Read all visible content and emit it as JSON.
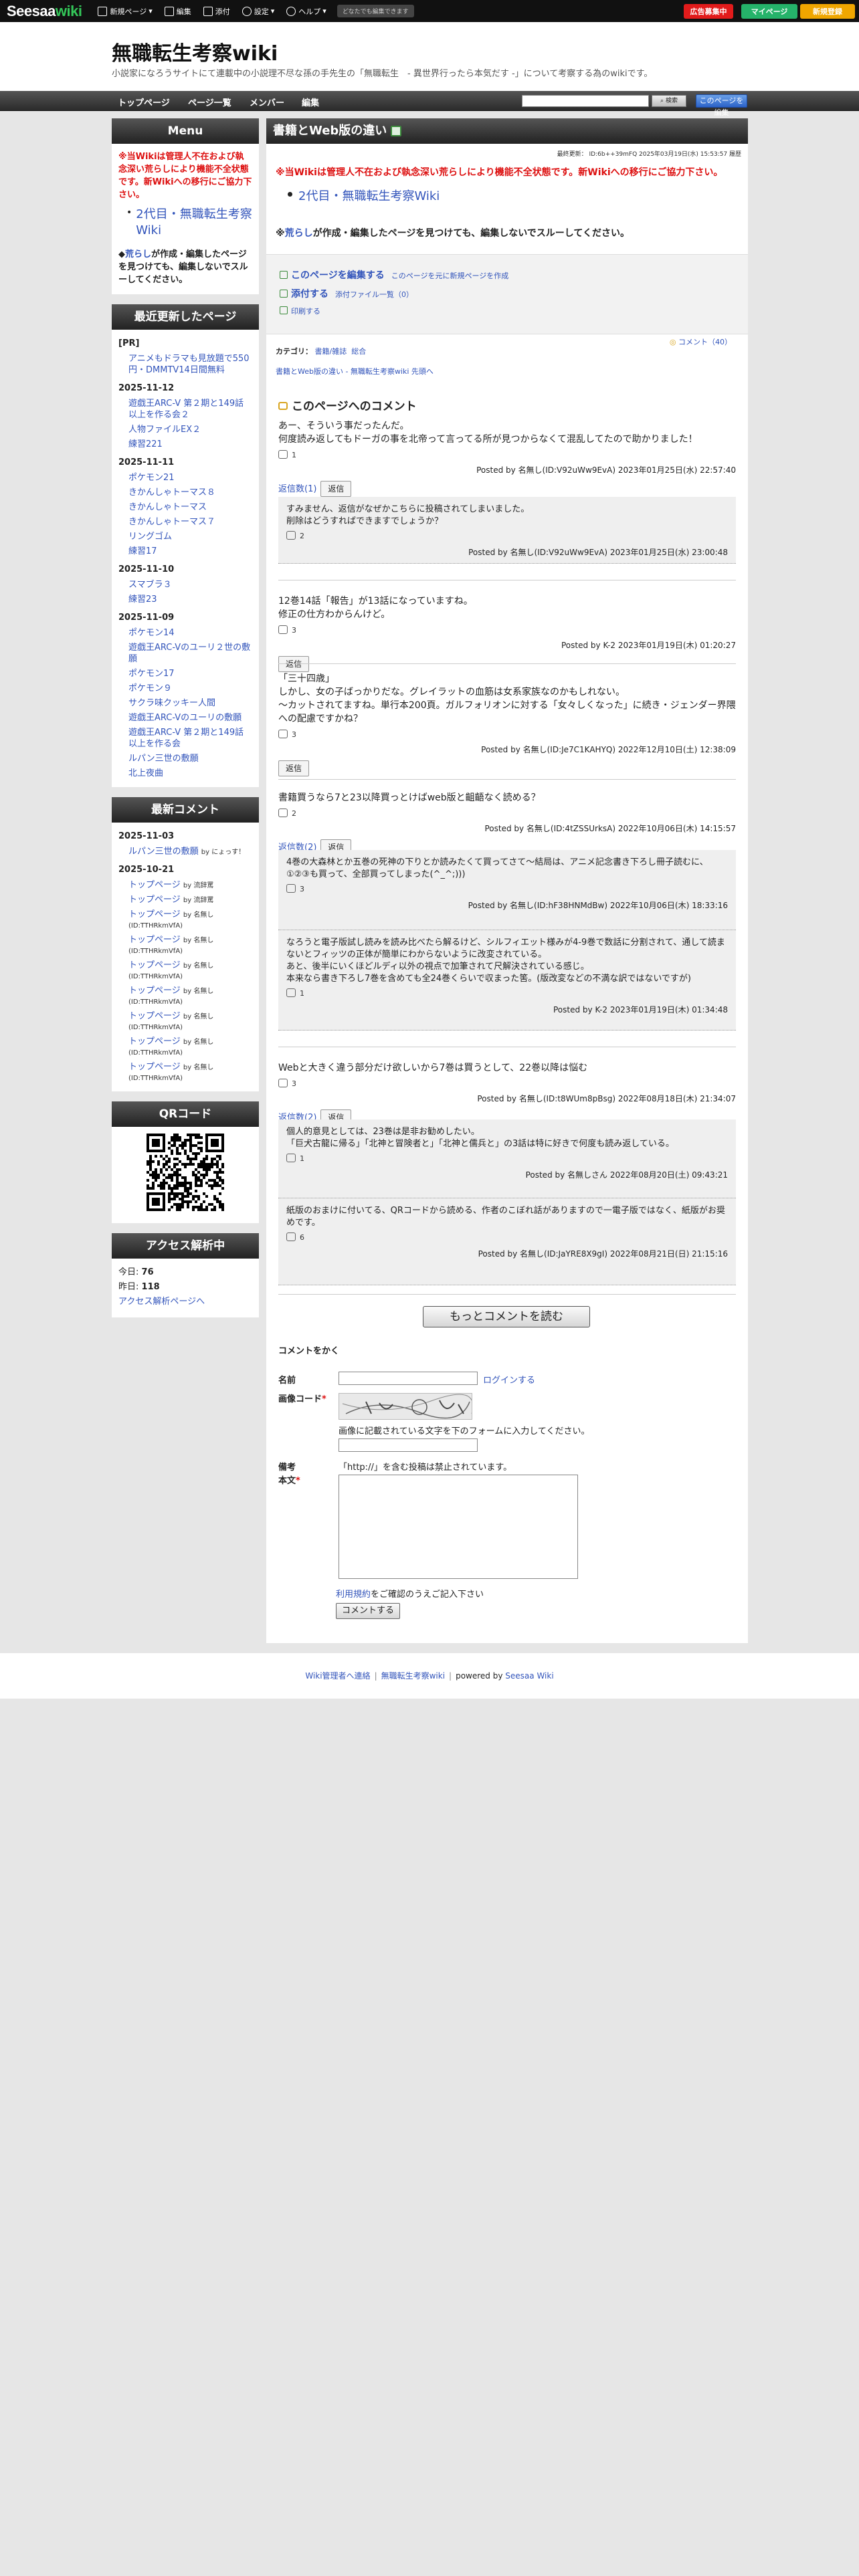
{
  "topbar": {
    "logo_a": "Seesaa",
    "logo_b": "wiki",
    "new_page": "新規ページ",
    "edit": "編集",
    "attach": "添付",
    "settings": "設定",
    "help": "ヘルプ",
    "notice_pill": "どなたでも編集できます",
    "ad_btn": "広告募集中",
    "mypage_btn": "マイページ",
    "register_btn": "新規登録"
  },
  "header": {
    "title": "無職転生考察wiki",
    "subtitle": "小説家になろうサイトにて連載中の小説理不尽な孫の手先生の「無職転生　- 異世界行ったら本気だす -」について考察する為のwikiです。"
  },
  "nav": {
    "items": [
      "トップページ",
      "ページ一覧",
      "メンバー",
      "編集"
    ],
    "search_btn": "検索",
    "edit_btn": "このページを編集"
  },
  "sidebar": {
    "menu_title": "Menu",
    "menu_notice": "※当Wikiは管理人不在および執念深い荒らしにより機能不全状態です。新Wikiへの移行にご協力下さい。",
    "menu_link": "2代目・無職転生考察Wiki",
    "menu_notice2_a": "荒らし",
    "menu_notice2_b": "が作成・編集したページを見つけても、編集しないでスルーしてください。",
    "recent_title": "最近更新したページ",
    "recent": [
      {
        "date": "[PR]",
        "items": [
          "アニメもドラマも見放題で550円・DMMTV14日間無料"
        ]
      },
      {
        "date": "2025-11-12",
        "items": [
          "遊戯王ARC-V 第２期と149話以上を作る会２",
          "人物ファイルEX２",
          "練習221"
        ]
      },
      {
        "date": "2025-11-11",
        "items": [
          "ポケモン21",
          "きかんしゃトーマス８",
          "きかんしゃトーマス",
          "きかんしゃトーマス７",
          "リングゴム",
          "練習17"
        ]
      },
      {
        "date": "2025-11-10",
        "items": [
          "スマブラ３",
          "練習23"
        ]
      },
      {
        "date": "2025-11-09",
        "items": [
          "ポケモン14",
          "遊戯王ARC-Vのユーリ２世の敷願",
          "ポケモン17",
          "ポケモン９",
          "サクラ味クッキー人間",
          "遊戯王ARC-Vのユーリの敷願",
          "遊戯王ARC-V 第２期と149話以上を作る会",
          "ルパン三世の敷願",
          "北上夜曲"
        ]
      }
    ],
    "latest_title": "最新コメント",
    "latest": [
      {
        "date": "2025-11-03",
        "items": [
          {
            "page": "ルパン三世の敷願",
            "by": "by にょっす！"
          }
        ]
      },
      {
        "date": "2025-10-21",
        "items": [
          {
            "page": "トップページ",
            "by": "by 流辞罵"
          },
          {
            "page": "トップページ",
            "by": "by 流辞罵"
          },
          {
            "page": "トップページ",
            "by": "by 名無し(ID:TTHRkmVfA)"
          },
          {
            "page": "トップページ",
            "by": "by 名無し(ID:TTHRkmVfA)"
          },
          {
            "page": "トップページ",
            "by": "by 名無し(ID:TTHRkmVfA)"
          },
          {
            "page": "トップページ",
            "by": "by 名無し(ID:TTHRkmVfA)"
          },
          {
            "page": "トップページ",
            "by": "by 名無し(ID:TTHRkmVfA)"
          },
          {
            "page": "トップページ",
            "by": "by 名無し(ID:TTHRkmVfA)"
          },
          {
            "page": "トップページ",
            "by": "by 名無し(ID:TTHRkmVfA)"
          }
        ]
      }
    ],
    "qr_title": "QRコード",
    "access_title": "アクセス解析中",
    "today_label": "今日:",
    "today_value": "76",
    "yesterday_label": "昨日:",
    "yesterday_value": "118",
    "access_link": "アクセス解析ページへ"
  },
  "main": {
    "page_title": "書籍とWeb版の違い",
    "updated": "最終更新： ID:6b++39mFQ 2025年03月19日(水) 15:53:57 履歴",
    "notice": "※当Wikiは管理人不在および執念深い荒らしにより機能不全状態です。新Wikiへの移行にご協力下さい。",
    "wiki_link": "2代目・無職転生考察Wiki",
    "notice2_a": "※",
    "notice2_b": "荒らし",
    "notice2_c": "が作成・編集したページを見つけても、編集しないでスルーしてください。",
    "edit_this": "このページを編集する",
    "edit_this_sub": "このページを元に新規ページを作成",
    "attach": "添付する",
    "attach_sub": "添付ファイル一覧（0）",
    "print": "印刷する",
    "comment_count": "コメント（40）",
    "category_label": "カテゴリ：",
    "category_items": [
      "書籍/雑誌",
      "総合"
    ],
    "breadcrumb": "書籍とWeb版の違い - 無職転生考察wiki 先頭へ",
    "comments_header": "このページへのコメント",
    "more_btn": "もっとコメントを読む"
  },
  "comments": [
    {
      "text": [
        "あー、そういう事だったんだ。",
        "何度読み返してもドーガの事を北帝って言ってる所が見つからなくて混乱してたので助かりました！"
      ],
      "likes": "1",
      "posted": "Posted by 名無し(ID:V92uWw9EvA) 2023年01月25日(水) 22:57:40",
      "reply_count": "返信数(1)",
      "reply_btn": "返信"
    },
    {
      "text": [
        "12巻14話「報告」が13話になっていますね。",
        "修正の仕方わからんけど。"
      ],
      "likes": "3",
      "posted": "Posted by K-2 2023年01月19日(木) 01:20:27",
      "reply_btn": "返信"
    },
    {
      "text": [
        "「三十四歳」",
        "しかし、女の子ばっかりだな。グレイラットの血筋は女系家族なのかもしれない。",
        "～カットされてますね。単行本200頁。ガルフォリオンに対する「女々しくなった」に続き・ジェンダー界隈への配慮ですかね？"
      ],
      "likes": "3",
      "posted": "Posted by 名無し(ID:Je7C1KAHYQ) 2022年12月10日(土) 12:38:09",
      "reply_btn": "返信"
    },
    {
      "text": [
        "書籍買うなら7と23以降買っとけばweb版と齟齬なく読める？"
      ],
      "likes": "2",
      "posted": "Posted by 名無し(ID:4tZSSUrksA) 2022年10月06日(木) 14:15:57",
      "reply_count": "返信数(2)",
      "reply_btn": "返信"
    },
    {
      "text": [
        "Webと大きく違う部分だけ欲しいから7巻は買うとして、22巻以降は悩む"
      ],
      "likes": "3",
      "posted": "Posted by 名無し(ID:t8WUm8pBsg) 2022年08月18日(木) 21:34:07",
      "reply_count": "返信数(2)",
      "reply_btn": "返信"
    }
  ],
  "replies": [
    {
      "text": [
        "すみません、返信がなぜかこちらに投稿されてしまいました。",
        "削除はどうすればできますでしょうか？"
      ],
      "likes": "2",
      "posted": "Posted by 名無し(ID:V92uWw9EvA) 2023年01月25日(水) 23:00:48"
    },
    {
      "text": [
        "4巻の大森林とか五巻の死神の下りとか読みたくて買ってさて～結局は、アニメ記念書き下ろし冊子読むに、①②③も買って、全部買ってしまった(^_^;)))"
      ],
      "likes": "3",
      "posted": "Posted by 名無し(ID:hF38HNMdBw) 2022年10月06日(木) 18:33:16"
    },
    {
      "text": [
        "なろうと電子版試し読みを読み比べたら解るけど、シルフィエット様みが4-9巻で数話に分割されて、通して読まないとフィッツの正体が簡単にわからないように改変されている。",
        "あと、後半にいくほどルディ以外の視点で加筆されて尺解決されている感じ。",
        "本来なら書き下ろし7巻を含めても全24巻くらいで収まった筈。(版改変などの不満な訳ではないですが)"
      ],
      "likes": "1",
      "posted": "Posted by K-2 2023年01月19日(木) 01:34:48"
    },
    {
      "text": [
        "個人的意見としては、23巻は是非お勧めしたい。",
        "「巨犬古龍に帰る」「北神と冒険者と」「北神と儒兵と」の3話は特に好きで何度も読み返している。"
      ],
      "likes": "1",
      "posted": "Posted by 名無しさん 2022年08月20日(土) 09:43:21"
    },
    {
      "text": [
        "紙版のおまけに付いてる、QRコードから読める、作者のこぼれ話がありますので一電子版ではなく、紙版がお奨めです。"
      ],
      "likes": "6",
      "posted": "Posted by 名無し(ID:JaYRE8X9gI) 2022年08月21日(日) 21:15:16"
    }
  ],
  "form": {
    "header": "コメントをかく",
    "name_label": "名前",
    "login_link": "ログインする",
    "captcha_label": "画像コード",
    "captcha_hint": "画像に記載されている文字を下のフォームに入力してください。",
    "note_label": "備考",
    "note_text": "「http://」を含む投稿は禁止されています。",
    "body_label": "本文",
    "terms_link": "利用規約",
    "terms_text": "をご確認のうえご記入下さい",
    "submit": "コメントする"
  },
  "footer": {
    "contact": "Wiki管理者へ連絡",
    "site": "無職転生考察wiki",
    "powered_by": "powered by",
    "seesaa": "Seesaa Wiki"
  },
  "colors": {
    "accent": "#3355bb",
    "red": "#dd1111",
    "dark": "#222222"
  }
}
